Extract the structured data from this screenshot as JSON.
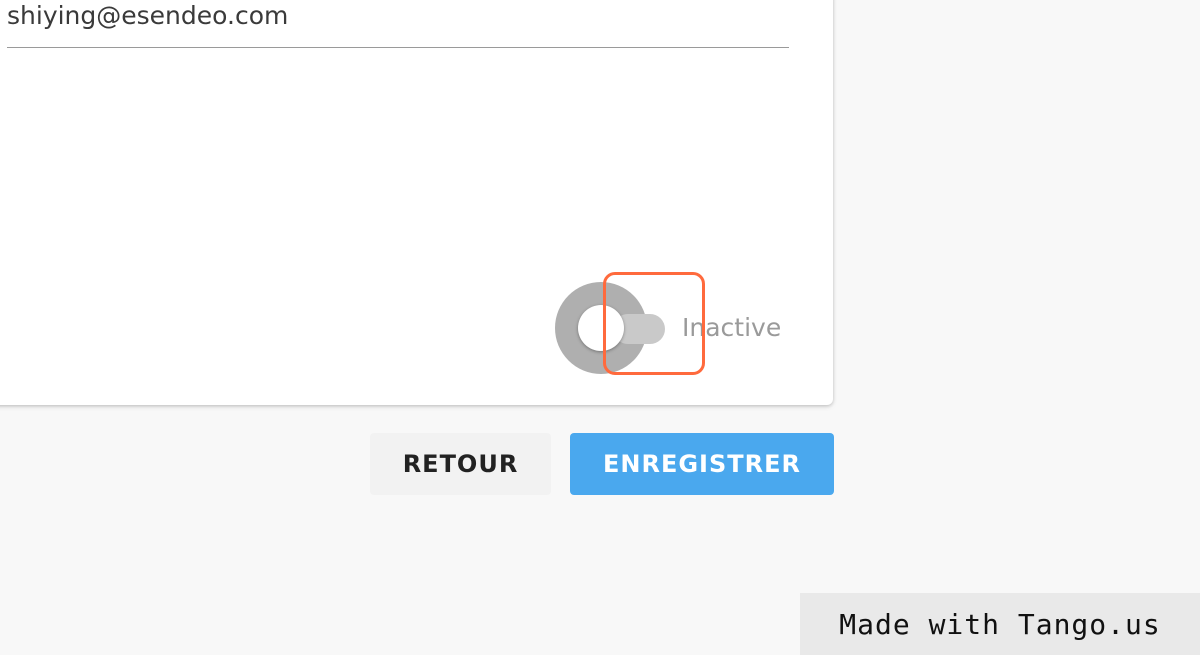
{
  "form": {
    "email_value": "shiying@esendeo.com",
    "status_label": "Inactive",
    "status_active": false
  },
  "actions": {
    "back_label": "RETOUR",
    "save_label": "ENREGISTRER"
  },
  "watermark": {
    "text": "Made with Tango.us"
  },
  "colors": {
    "primary": "#4aa8ee",
    "highlight": "#ff6a3d",
    "background": "#f8f8f8"
  }
}
